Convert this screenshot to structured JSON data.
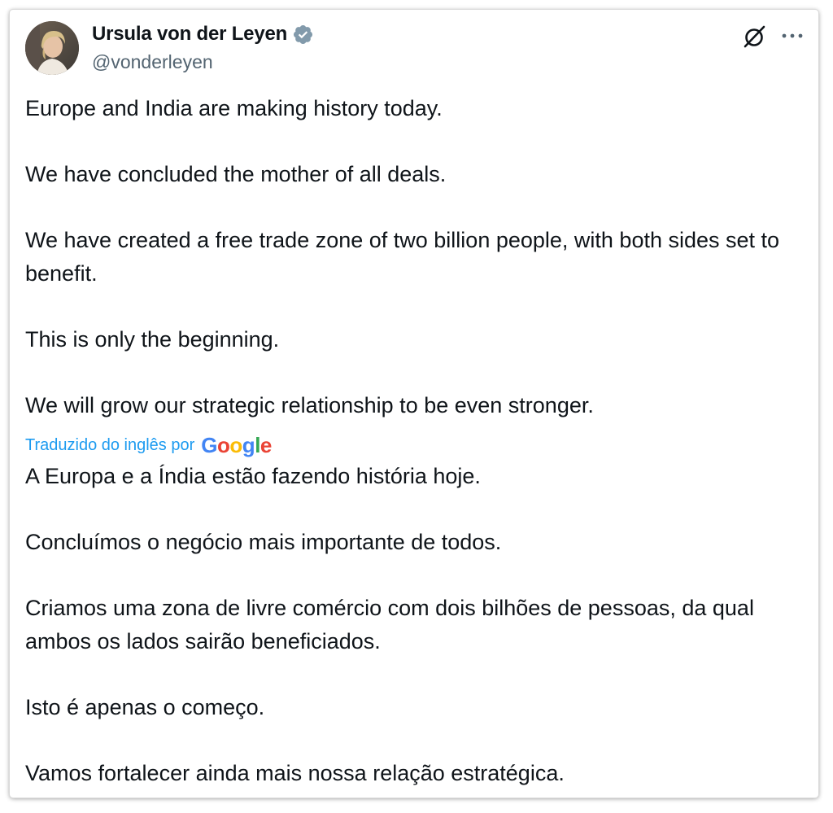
{
  "author": {
    "display_name": "Ursula von der Leyen",
    "handle": "@vonderleyen",
    "verified": true,
    "avatar": "profile-photo"
  },
  "icons": {
    "verified": "verified-badge-icon",
    "grok": "grok-icon",
    "more": "more-options-icon"
  },
  "tweet": {
    "paragraphs": [
      "Europe and India are making history today.",
      "We have concluded the mother of all deals.",
      "We have created a free trade zone of two billion people, with both sides set to benefit.",
      "This is only the beginning.",
      "We will grow our strategic relationship to be even stronger."
    ]
  },
  "translation": {
    "label": "Traduzido do inglês por",
    "provider": "Google",
    "paragraphs": [
      "A Europa e a Índia estão fazendo história hoje.",
      "Concluímos o negócio mais importante de todos.",
      "Criamos uma zona de livre comércio com dois bilhões de pessoas, da qual ambos os lados sairão beneficiados.",
      "Isto é apenas o começo.",
      "Vamos fortalecer ainda mais nossa relação estratégica."
    ]
  },
  "colors": {
    "text": "#0f1419",
    "secondary": "#536471",
    "link": "#1d9bf0",
    "verified_badge": "#829aab"
  }
}
